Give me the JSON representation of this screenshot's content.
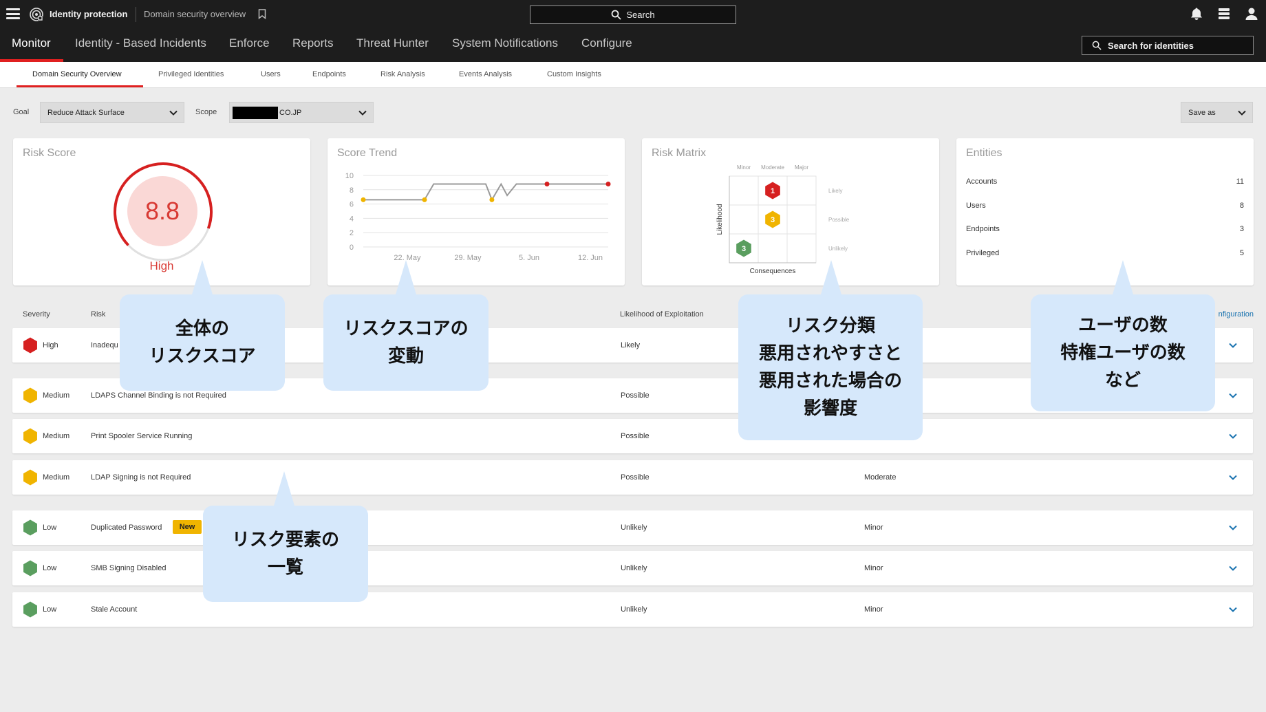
{
  "topbar": {
    "app_name": "Identity protection",
    "page_crumb": "Domain security overview",
    "search_label": "Search"
  },
  "mainnav": {
    "tabs": [
      "Monitor",
      "Identity - Based Incidents",
      "Enforce",
      "Reports",
      "Threat Hunter",
      "System Notifications",
      "Configure"
    ],
    "identity_search": "Search for identities"
  },
  "subnav": {
    "tabs": [
      "Domain Security Overview",
      "Privileged Identities",
      "Users",
      "Endpoints",
      "Risk Analysis",
      "Events Analysis",
      "Custom Insights"
    ]
  },
  "filters": {
    "goal_label": "Goal",
    "goal_value": "Reduce Attack Surface",
    "scope_label": "Scope",
    "scope_value": "CO.JP",
    "save_label": "Save as"
  },
  "risk_score": {
    "title": "Risk Score",
    "value": "8.8",
    "level": "High"
  },
  "score_trend": {
    "title": "Score Trend"
  },
  "chart_data": {
    "type": "line",
    "title": "Score Trend",
    "x_ticks": [
      "22. May",
      "29. May",
      "5. Jun",
      "12. Jun"
    ],
    "y_ticks": [
      "0",
      "2",
      "4",
      "6",
      "8",
      "10"
    ],
    "ylim": [
      0,
      10
    ],
    "series": [
      {
        "points": [
          [
            0,
            6.6
          ],
          [
            10,
            6.6
          ],
          [
            11.5,
            8.8
          ],
          [
            20,
            8.8
          ],
          [
            21,
            6.6
          ],
          [
            22.5,
            8.8
          ],
          [
            23.5,
            7.2
          ],
          [
            25,
            8.8
          ],
          [
            30,
            8.8
          ],
          [
            40,
            8.8
          ]
        ],
        "markers": [
          {
            "i": 0,
            "color": "#f0b400"
          },
          {
            "i": 1,
            "color": "#f0b400"
          },
          {
            "i": 4,
            "color": "#f0b400"
          },
          {
            "i": 8,
            "color": "#d62020"
          },
          {
            "i": 9,
            "color": "#d62020"
          }
        ]
      }
    ],
    "grid": true
  },
  "risk_matrix": {
    "title": "Risk Matrix",
    "cols": [
      "Minor",
      "Moderate",
      "Major"
    ],
    "rows": [
      "Likely",
      "Possible",
      "Unlikely"
    ],
    "ylabel": "Likelihood",
    "xlabel": "Consequences",
    "cells": [
      {
        "row": 0,
        "col": 1,
        "count": "1",
        "color": "#d62020"
      },
      {
        "row": 1,
        "col": 1,
        "count": "3",
        "color": "#f0b400"
      },
      {
        "row": 2,
        "col": 0,
        "count": "3",
        "color": "#5a9e5f"
      }
    ]
  },
  "entities": {
    "title": "Entities",
    "items": [
      {
        "label": "Accounts",
        "value": "11"
      },
      {
        "label": "Users",
        "value": "8"
      },
      {
        "label": "Endpoints",
        "value": "3"
      },
      {
        "label": "Privileged",
        "value": "5"
      }
    ]
  },
  "table": {
    "headers": {
      "severity": "Severity",
      "risk": "Risk",
      "likelihood": "Likelihood of Exploitation",
      "config": "nfiguration"
    },
    "rows": [
      {
        "severity": "High",
        "color": "#d62020",
        "risk": "Inadequ",
        "likelihood": "Likely",
        "consequence": "",
        "badge": ""
      },
      {
        "severity": "Medium",
        "color": "#f0b400",
        "risk": "LDAPS Channel Binding is not Required",
        "likelihood": "Possible",
        "consequence": "",
        "badge": ""
      },
      {
        "severity": "Medium",
        "color": "#f0b400",
        "risk": "Print Spooler Service Running",
        "likelihood": "Possible",
        "consequence": "",
        "badge": ""
      },
      {
        "severity": "Medium",
        "color": "#f0b400",
        "risk": "LDAP Signing is not Required",
        "likelihood": "Possible",
        "consequence": "Moderate",
        "badge": ""
      },
      {
        "severity": "Low",
        "color": "#5a9e5f",
        "risk": "Duplicated Password",
        "likelihood": "Unlikely",
        "consequence": "Minor",
        "badge": "New"
      },
      {
        "severity": "Low",
        "color": "#5a9e5f",
        "risk": "SMB Signing Disabled",
        "likelihood": "Unlikely",
        "consequence": "Minor",
        "badge": ""
      },
      {
        "severity": "Low",
        "color": "#5a9e5f",
        "risk": "Stale Account",
        "likelihood": "Unlikely",
        "consequence": "Minor",
        "badge": ""
      }
    ]
  },
  "callouts": {
    "risk_score": [
      "全体の",
      "リスクスコア"
    ],
    "score_trend": [
      "リスクスコアの",
      "変動"
    ],
    "risk_matrix": [
      "リスク分類",
      "悪用されやすさと",
      "悪用された場合の",
      "影響度"
    ],
    "entities": [
      "ユーザの数",
      "特権ユーザの数",
      "など"
    ],
    "risk_list": [
      "リスク要素の",
      "一覧"
    ]
  }
}
